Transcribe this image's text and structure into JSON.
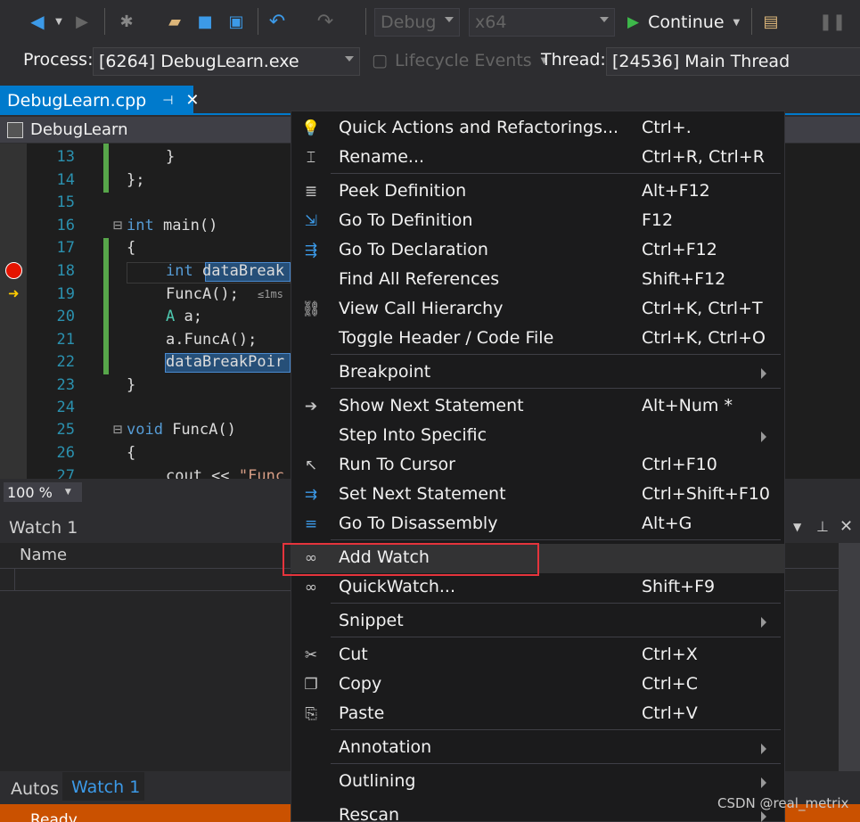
{
  "toolbar": {
    "config": "Debug",
    "platform": "x64",
    "continue_label": "Continue",
    "process_label": "Process:",
    "process_value": "[6264] DebugLearn.exe",
    "lifecycle_label": "Lifecycle Events",
    "thread_label": "Thread:",
    "thread_value": "[24536] Main Thread"
  },
  "tab": {
    "name": "DebugLearn.cpp",
    "pin": "⊣",
    "close": "✕"
  },
  "nav": {
    "scope": "DebugLearn"
  },
  "editor": {
    "lines": [
      {
        "n": "13",
        "text": "}"
      },
      {
        "n": "14",
        "text": "};"
      },
      {
        "n": "15",
        "text": ""
      },
      {
        "n": "16",
        "kw": "int",
        "text": " main()"
      },
      {
        "n": "17",
        "text": "{"
      },
      {
        "n": "18",
        "kw": "int",
        "text": " dataBreak"
      },
      {
        "n": "19",
        "text": "FuncA();",
        "hint": "≤1ms"
      },
      {
        "n": "20",
        "kw": "A",
        "text": " a;"
      },
      {
        "n": "21",
        "text": "a.FuncA();"
      },
      {
        "n": "22",
        "text": "dataBreakPoir"
      },
      {
        "n": "23",
        "text": "}"
      },
      {
        "n": "24",
        "text": ""
      },
      {
        "n": "25",
        "kw": "void",
        "text": " FuncA()"
      },
      {
        "n": "26",
        "text": "{"
      },
      {
        "n": "27",
        "text": "cout << ",
        "str": "\"Func"
      }
    ],
    "zoom": "100 %"
  },
  "watch": {
    "title": "Watch 1",
    "col_name": "Name"
  },
  "bottom_tabs": [
    {
      "label": "Autos"
    },
    {
      "label": "Watch 1"
    }
  ],
  "status": {
    "left": "Ready"
  },
  "menu": {
    "items": [
      {
        "label": "Quick Actions and Refactorings...",
        "shortcut": "Ctrl+.",
        "icon": "lightbulb-icon"
      },
      {
        "label": "Rename...",
        "shortcut": "Ctrl+R, Ctrl+R",
        "icon": "rename-icon"
      },
      {
        "label": "Peek Definition",
        "shortcut": "Alt+F12",
        "icon": "peek-definition-icon"
      },
      {
        "label": "Go To Definition",
        "shortcut": "F12",
        "icon": "go-to-definition-icon"
      },
      {
        "label": "Go To Declaration",
        "shortcut": "Ctrl+F12",
        "icon": "go-to-declaration-icon"
      },
      {
        "label": "Find All References",
        "shortcut": "Shift+F12",
        "icon": ""
      },
      {
        "label": "View Call Hierarchy",
        "shortcut": "Ctrl+K, Ctrl+T",
        "icon": "call-hierarchy-icon"
      },
      {
        "label": "Toggle Header / Code File",
        "shortcut": "Ctrl+K, Ctrl+O",
        "icon": ""
      },
      {
        "label": "Breakpoint",
        "shortcut": "",
        "icon": "",
        "submenu": true
      },
      {
        "label": "Show Next Statement",
        "shortcut": "Alt+Num *",
        "icon": "arrow-right-icon"
      },
      {
        "label": "Step Into Specific",
        "shortcut": "",
        "icon": "",
        "submenu": true
      },
      {
        "label": "Run To Cursor",
        "shortcut": "Ctrl+F10",
        "icon": "cursor-icon"
      },
      {
        "label": "Set Next Statement",
        "shortcut": "Ctrl+Shift+F10",
        "icon": "set-next-statement-icon"
      },
      {
        "label": "Go To Disassembly",
        "shortcut": "Alt+G",
        "icon": "disassembly-icon"
      },
      {
        "label": "Add Watch",
        "shortcut": "",
        "icon": "glasses-icon"
      },
      {
        "label": "QuickWatch...",
        "shortcut": "Shift+F9",
        "icon": "glasses-icon"
      },
      {
        "label": "Snippet",
        "shortcut": "",
        "icon": "",
        "submenu": true
      },
      {
        "label": "Cut",
        "shortcut": "Ctrl+X",
        "icon": "scissors-icon"
      },
      {
        "label": "Copy",
        "shortcut": "Ctrl+C",
        "icon": "copy-icon"
      },
      {
        "label": "Paste",
        "shortcut": "Ctrl+V",
        "icon": "paste-icon"
      },
      {
        "label": "Annotation",
        "shortcut": "",
        "icon": "",
        "submenu": true
      },
      {
        "label": "Outlining",
        "shortcut": "",
        "icon": "",
        "submenu": true
      },
      {
        "label": "Rescan",
        "shortcut": "",
        "icon": "",
        "submenu": true
      }
    ]
  },
  "watermark": "CSDN @real_metrix",
  "colors": {
    "accent": "#007acc",
    "status": "#ca5100",
    "highlight": "#e5343c"
  }
}
